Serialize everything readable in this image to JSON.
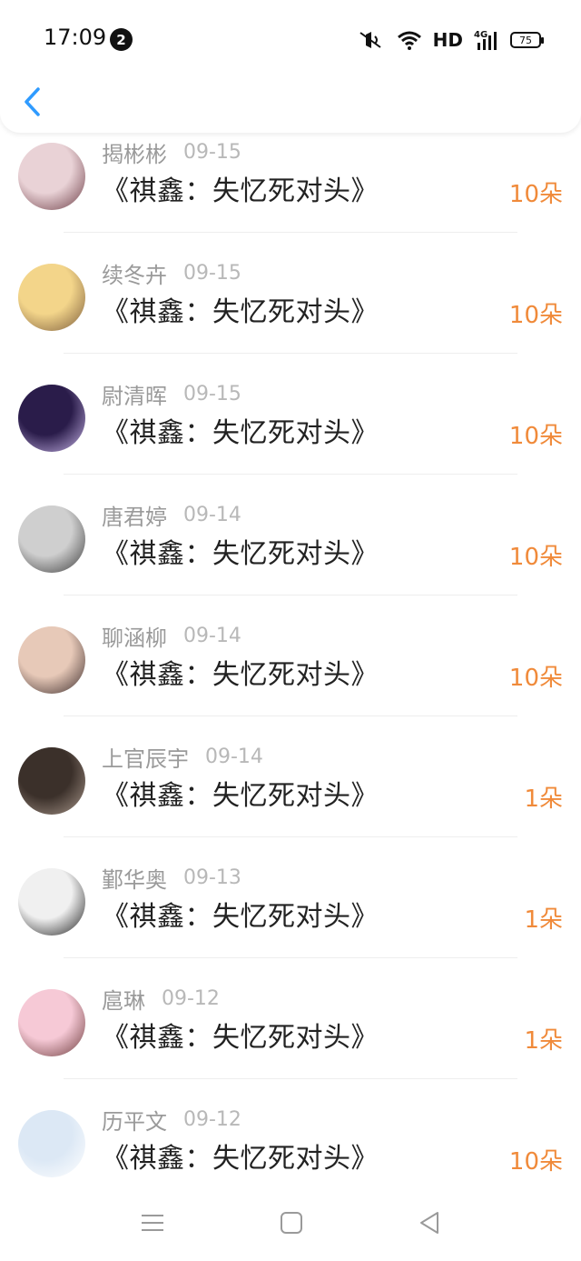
{
  "status_bar": {
    "time": "17:09",
    "notification_count": "2",
    "network": "HD",
    "signal": "4G",
    "battery": "75"
  },
  "header": {
    "back_icon": "chevron-left-icon"
  },
  "list": [
    {
      "name": "揭彬彬",
      "date": "09-15",
      "book": "《祺鑫：失忆死对头》",
      "amount": "10朵",
      "avatar_colors": [
        "#e9d2d6",
        "#6b3b44"
      ]
    },
    {
      "name": "续冬卉",
      "date": "09-15",
      "book": "《祺鑫：失忆死对头》",
      "amount": "10朵",
      "avatar_colors": [
        "#f3d58a",
        "#7a5a3a"
      ]
    },
    {
      "name": "尉清晖",
      "date": "09-15",
      "book": "《祺鑫：失忆死对头》",
      "amount": "10朵",
      "avatar_colors": [
        "#2a1c4a",
        "#c8b5e8"
      ]
    },
    {
      "name": "唐君婷",
      "date": "09-14",
      "book": "《祺鑫：失忆死对头》",
      "amount": "10朵",
      "avatar_colors": [
        "#cfcfcf",
        "#3a3a3a"
      ]
    },
    {
      "name": "聊涵柳",
      "date": "09-14",
      "book": "《祺鑫：失忆死对头》",
      "amount": "10朵",
      "avatar_colors": [
        "#e7c9b8",
        "#3b2b2b"
      ]
    },
    {
      "name": "上官辰宇",
      "date": "09-14",
      "book": "《祺鑫：失忆死对头》",
      "amount": "1朵",
      "avatar_colors": [
        "#3b302a",
        "#a8978b"
      ]
    },
    {
      "name": "鄞华奥",
      "date": "09-13",
      "book": "《祺鑫：失忆死对头》",
      "amount": "1朵",
      "avatar_colors": [
        "#f0f0f0",
        "#1c1c1c"
      ]
    },
    {
      "name": "扈琳",
      "date": "09-12",
      "book": "《祺鑫：失忆死对头》",
      "amount": "1朵",
      "avatar_colors": [
        "#f6c9d6",
        "#6b3a3a"
      ]
    },
    {
      "name": "历平文",
      "date": "09-12",
      "book": "《祺鑫：失忆死对头》",
      "amount": "10朵",
      "avatar_colors": [
        "#dce8f5",
        "#ffffff"
      ]
    }
  ],
  "nav": {
    "menu_icon": "menu-icon",
    "home_icon": "home-square-icon",
    "back_icon": "back-triangle-icon"
  },
  "colors": {
    "accent": "#f08a3a",
    "back_blue": "#2f9bff"
  }
}
